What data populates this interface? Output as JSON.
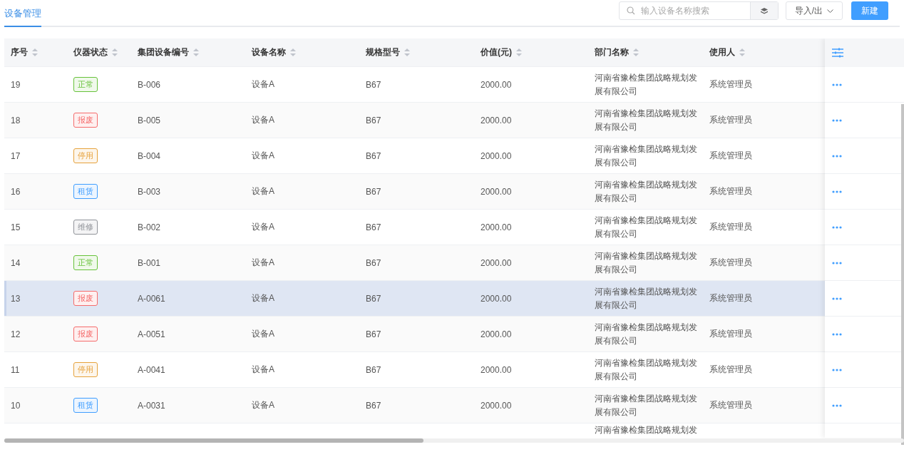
{
  "tabs": [
    {
      "label": "设备管理",
      "selected": true
    }
  ],
  "search": {
    "placeholder": "输入设备名称搜索"
  },
  "import_export": {
    "label": "导入/出"
  },
  "new_button": {
    "label": "新建"
  },
  "columns": [
    "序号",
    "仪器状态",
    "集团设备编号",
    "设备名称",
    "规格型号",
    "价值(元)",
    "部门名称",
    "使用人"
  ],
  "rows": [
    {
      "no": "19",
      "status": "正常",
      "color": "#67c23a",
      "code": "B-006",
      "name": "设备A",
      "model": "B67",
      "value": "2000.00",
      "dept": "河南省豫检集团战略规划发展有限公司",
      "user": "系统管理员",
      "hovered": false
    },
    {
      "no": "18",
      "status": "报废",
      "color": "#f56c6c",
      "code": "B-005",
      "name": "设备A",
      "model": "B67",
      "value": "2000.00",
      "dept": "河南省豫检集团战略规划发展有限公司",
      "user": "系统管理员",
      "hovered": false
    },
    {
      "no": "17",
      "status": "停用",
      "color": "#e6a23c",
      "code": "B-004",
      "name": "设备A",
      "model": "B67",
      "value": "2000.00",
      "dept": "河南省豫检集团战略规划发展有限公司",
      "user": "系统管理员",
      "hovered": false
    },
    {
      "no": "16",
      "status": "租赁",
      "color": "#409eff",
      "code": "B-003",
      "name": "设备A",
      "model": "B67",
      "value": "2000.00",
      "dept": "河南省豫检集团战略规划发展有限公司",
      "user": "系统管理员",
      "hovered": false
    },
    {
      "no": "15",
      "status": "维修",
      "color": "#909399",
      "code": "B-002",
      "name": "设备A",
      "model": "B67",
      "value": "2000.00",
      "dept": "河南省豫检集团战略规划发展有限公司",
      "user": "系统管理员",
      "hovered": false
    },
    {
      "no": "14",
      "status": "正常",
      "color": "#67c23a",
      "code": "B-001",
      "name": "设备A",
      "model": "B67",
      "value": "2000.00",
      "dept": "河南省豫检集团战略规划发展有限公司",
      "user": "系统管理员",
      "hovered": false
    },
    {
      "no": "13",
      "status": "报废",
      "color": "#f56c6c",
      "code": "A-0061",
      "name": "设备A",
      "model": "B67",
      "value": "2000.00",
      "dept": "河南省豫检集团战略规划发展有限公司",
      "user": "系统管理员",
      "hovered": true
    },
    {
      "no": "12",
      "status": "报废",
      "color": "#f56c6c",
      "code": "A-0051",
      "name": "设备A",
      "model": "B67",
      "value": "2000.00",
      "dept": "河南省豫检集团战略规划发展有限公司",
      "user": "系统管理员",
      "hovered": false
    },
    {
      "no": "11",
      "status": "停用",
      "color": "#e6a23c",
      "code": "A-0041",
      "name": "设备A",
      "model": "B67",
      "value": "2000.00",
      "dept": "河南省豫检集团战略规划发展有限公司",
      "user": "系统管理员",
      "hovered": false
    },
    {
      "no": "10",
      "status": "租赁",
      "color": "#409eff",
      "code": "A-0031",
      "name": "设备A",
      "model": "B67",
      "value": "2000.00",
      "dept": "河南省豫检集团战略规划发展有限公司",
      "user": "系统管理员",
      "hovered": false
    }
  ],
  "partial_row": {
    "dept": "河南省豫检集团战略规划发"
  }
}
